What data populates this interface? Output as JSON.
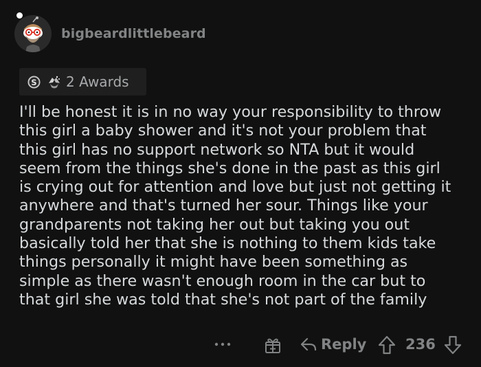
{
  "comment": {
    "author": "bigbeardlittlebeard",
    "awards_label": "2 Awards",
    "body": "I'll be honest it is in no way your responsibility to throw\nthis girl a baby shower and it's not your problem that\nthis girl has no support network so NTA but it would\nseem from the things she's done in the past as this girl\nis crying out for attention and love but just not getting it\nanywhere and that's turned her sour. Things like your\ngrandparents not taking her out but taking you out\nbasically told her that she is nothing to them kids take\nthings personally it might have been something as\nsimple as there wasn't enough room in the car but to\nthat girl she was told that she's not part of the family"
  },
  "actions": {
    "more_icon": "ellipsis-icon",
    "gift_icon": "gift-icon",
    "reply_label": "Reply",
    "score": "236"
  },
  "colors": {
    "background": "#111111",
    "text": "#d7dadc",
    "muted": "#818384",
    "award_bg": "#1f1f20"
  }
}
